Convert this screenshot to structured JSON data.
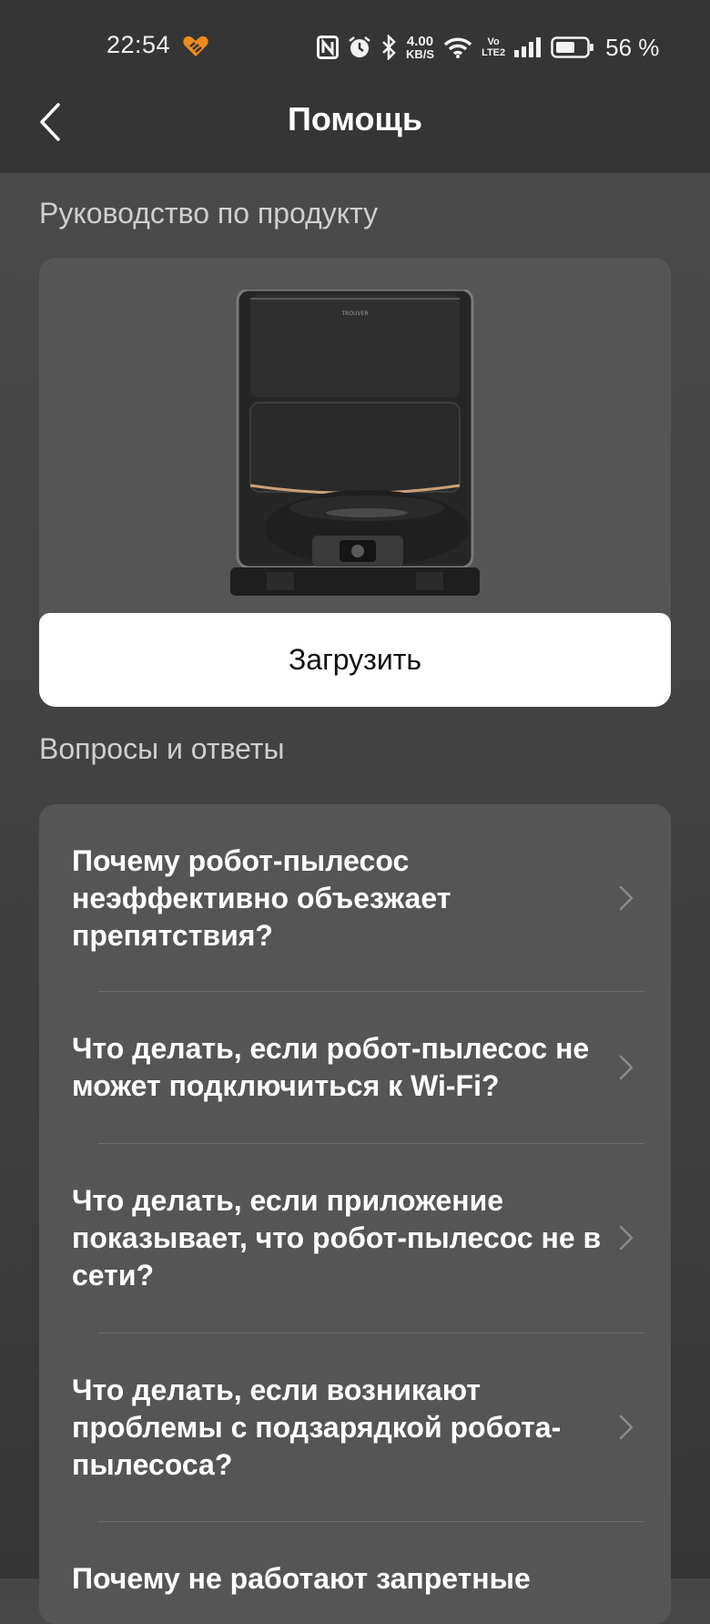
{
  "status_bar": {
    "time": "22:54",
    "net_speed_value": "4.00",
    "net_speed_unit": "KB/S",
    "volte_top": "Vo",
    "volte_bottom": "LTE2",
    "battery_percent": "56 %",
    "icons": [
      "app-heart-icon",
      "nfc-icon",
      "alarm-icon",
      "bluetooth-icon",
      "wifi-icon",
      "volte-icon",
      "signal-icon",
      "battery-icon"
    ]
  },
  "header": {
    "title": "Помощь",
    "back_icon": "chevron-left-icon"
  },
  "manual_section": {
    "heading": "Руководство по продукту",
    "product_image": "robot-vacuum-station",
    "product_brand": "TROUVER",
    "download_label": "Загрузить"
  },
  "faq_section": {
    "heading": "Вопросы и ответы",
    "items": [
      {
        "question": "Почему робот-пылесос неэффективно объезжает препятствия?"
      },
      {
        "question": "Что делать, если робот-пылесос не может подключиться к Wi-Fi?"
      },
      {
        "question": "Что делать, если приложение показывает, что робот-пылесос не в сети?"
      },
      {
        "question": "Что делать, если возникают проблемы с подзарядкой робота-пылесоса?"
      },
      {
        "question": "Почему не работают запретные"
      }
    ]
  },
  "colors": {
    "header_bg": "#353535",
    "page_bg": "#474747",
    "card_bg": "#555555",
    "button_bg": "#ffffff",
    "accent_orange": "#f08a1c"
  }
}
